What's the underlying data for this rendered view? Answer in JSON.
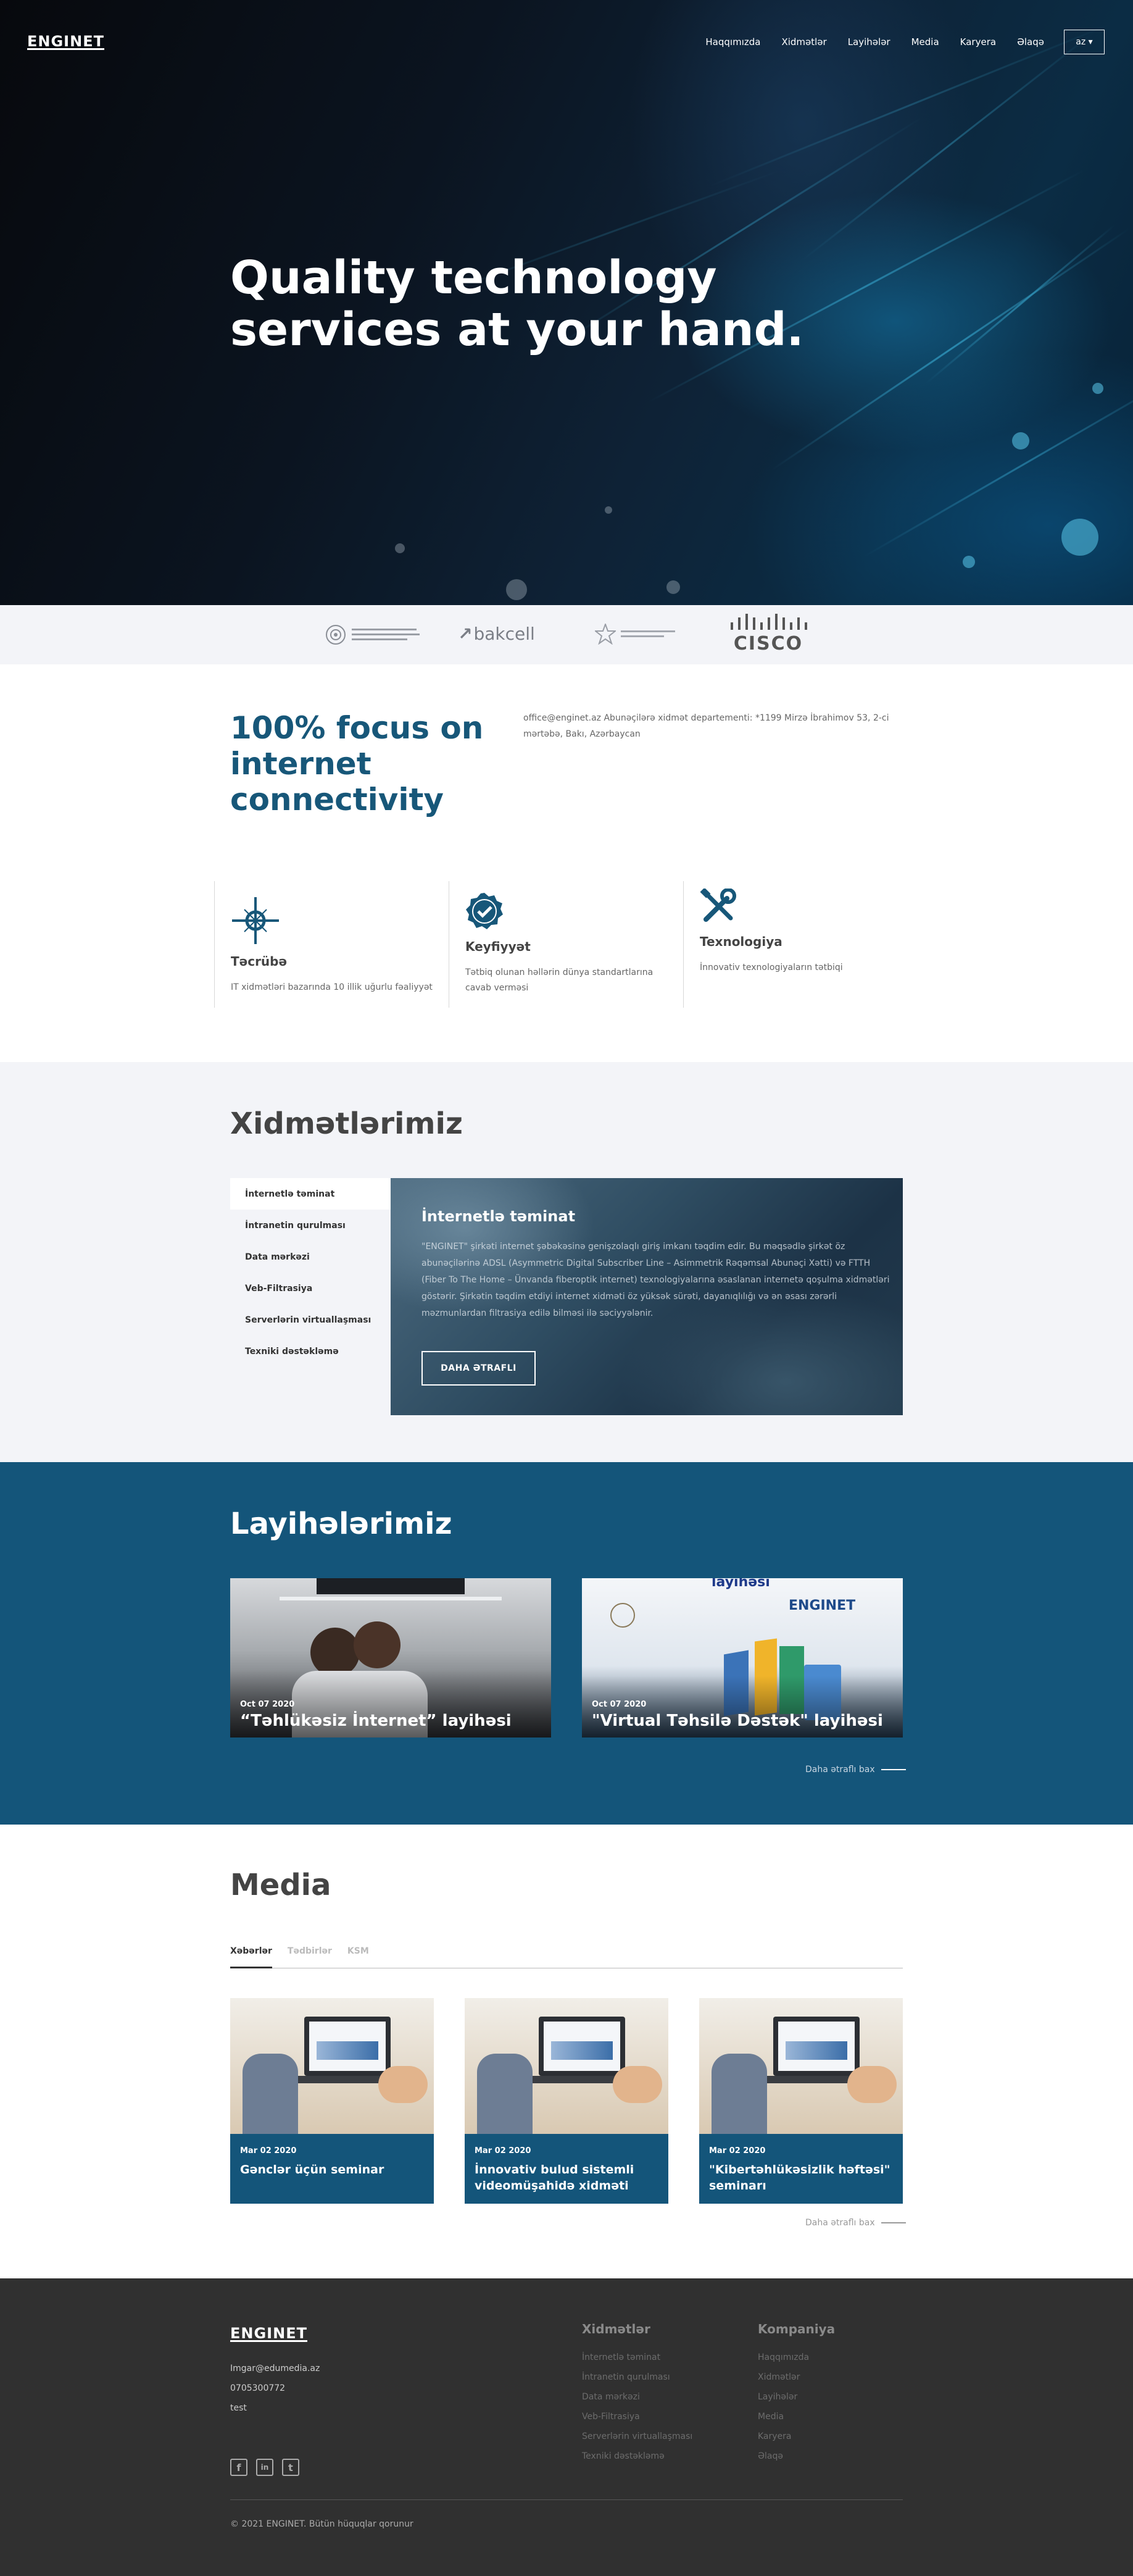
{
  "header": {
    "logo": "ENGINET",
    "nav": [
      "Haqqımızda",
      "Xidmətlər",
      "Layihələr",
      "Media",
      "Karyera",
      "Əlaqə"
    ],
    "lang": "az ▾"
  },
  "hero": {
    "title": "Quality technology services at your hand."
  },
  "partners": {
    "bakcell": "bakcell",
    "cisco": "CISCO"
  },
  "focus": {
    "title": "100% focus on internet connectivity",
    "contact": "office@enginet.az Abunəçilərə xidmət departementi: *1199 Mirzə İbrahimov 53, 2-ci mərtəbə, Bakı, Azərbaycan"
  },
  "features": [
    {
      "title": "Təcrübə",
      "text": "IT xidmətləri bazarında 10 illik uğurlu fəaliyyət"
    },
    {
      "title": "Keyfiyyət",
      "text": "Tətbiq olunan həllərin dünya standartlarına cavab verməsi"
    },
    {
      "title": "Texnologiya",
      "text": "İnnovativ texnologiyaların tətbiqi"
    }
  ],
  "services": {
    "title": "Xidmətlərimiz",
    "items": [
      "İnternetlə təminat",
      "İntranetin qurulması",
      "Data mərkəzi",
      "Veb-Filtrasiya",
      "Serverlərin virtuallaşması",
      "Texniki dəstəkləmə"
    ],
    "card": {
      "title": "İnternetlə təminat",
      "text": "\"ENGINET\" şirkəti internet şəbəkəsinə genişzolaqlı giriş imkanı təqdim edir. Bu məqsədlə şirkət öz abunəçilərinə ADSL (Asymmetric Digital Subscriber Line – Asimmetrik Rəqəmsal Abunəçi Xətti) və FTTH (Fiber To The Home – Ünvanda fiberoptik internet) texnologiyalarına əsaslanan internetə qoşulma xidmətləri göstərir. Şirkətin təqdim etdiyi internet xidməti öz yüksək sürəti, dayanıqlılığı və ən əsası zərərli məzmunlardan filtrasiya edilə bilməsi ilə səciyyələnir.",
      "button": "DAHA ƏTRAFLI"
    }
  },
  "projects": {
    "title": "Layihələrimiz",
    "items": [
      {
        "date": "Oct 07 2020",
        "title": "“Təhlükəsiz İnternet” layihəsi"
      },
      {
        "date": "Oct 07 2020",
        "title": "\"Virtual Təhsilə Dəstək\" layihəsi",
        "image_text": "layihəsi"
      }
    ],
    "more": "Daha ətraflı bax"
  },
  "media": {
    "title": "Media",
    "tabs": [
      "Xəbərlər",
      "Tədbirlər",
      "KSM"
    ],
    "items": [
      {
        "date": "Mar 02 2020",
        "title": "Gənclər üçün seminar"
      },
      {
        "date": "Mar 02 2020",
        "title": "İnnovativ bulud sistemli videomüşahidə xidməti"
      },
      {
        "date": "Mar 02 2020",
        "title": "\"Kibertəhlükəsizlik həftəsi\" seminarı"
      }
    ],
    "more": "Daha ətraflı bax"
  },
  "footer": {
    "logo": "ENGINET",
    "email": "Imgar@edumedia.az",
    "phone": "0705300772",
    "extra": "test",
    "col1": {
      "title": "Xidmətlər",
      "items": [
        "İnternetlə təminat",
        "İntranetin qurulması",
        "Data mərkəzi",
        "Veb-Filtrasiya",
        "Serverlərin virtuallaşması",
        "Texniki dəstəkləmə"
      ]
    },
    "col2": {
      "title": "Kompaniya",
      "items": [
        "Haqqımızda",
        "Xidmətlər",
        "Layihələr",
        "Media",
        "Karyera",
        "Əlaqə"
      ]
    },
    "social": [
      "f",
      "in",
      "t"
    ],
    "copyright": "© 2021 ENGINET. Bütün hüquqlar qorunur"
  },
  "colors": {
    "primary": "#14557a",
    "title_blue": "#175779",
    "footer": "#303030",
    "light_bg": "#f3f4f8"
  }
}
